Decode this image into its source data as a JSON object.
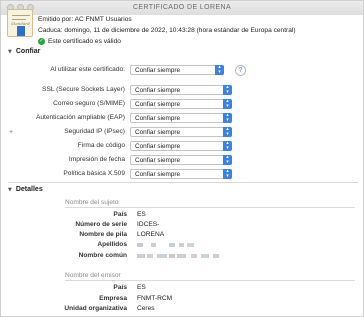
{
  "window": {
    "title": "CERTIFICADO DE LORENA"
  },
  "certificate": {
    "issuer": "Emitido por: AC FNMT Usuarios",
    "expires": "Caduca: domingo, 11 de diciembre de 2022, 10:43:28 (hora estándar de Europa central)",
    "valid": "Este certificado es válido",
    "icon_text": "Standard"
  },
  "confiar": {
    "section_title": "Confiar",
    "when_using_label": "Al utilizar este certificado:",
    "when_using_value": "Confiar siempre",
    "rows": [
      {
        "label": "SSL (Secure Sockets Layer)",
        "value": "Confiar siempre"
      },
      {
        "label": "Correo seguro (S/MIME)",
        "value": "Confiar siempre"
      },
      {
        "label": "Autenticación ampliable (EAP)",
        "value": "Confiar siempre"
      },
      {
        "label": "Seguridad IP (IPsec)",
        "value": "Confiar siempre"
      },
      {
        "label": "Firma de código",
        "value": "Confiar siempre"
      },
      {
        "label": "Impresión de fecha",
        "value": "Confiar siempre"
      },
      {
        "label": "Política básica X.509",
        "value": "Confiar siempre"
      }
    ]
  },
  "detalles": {
    "section_title": "Detalles",
    "subject": {
      "title": "Nombre del sujeto",
      "rows": [
        {
          "label": "País",
          "value": "ES"
        },
        {
          "label": "Número de serie",
          "value": "IDCES-"
        },
        {
          "label": "Nombre de pila",
          "value": "LORENA"
        },
        {
          "label": "Apellidos",
          "value": ""
        },
        {
          "label": "Nombre común",
          "value": ""
        }
      ]
    },
    "issuer": {
      "title": "Nombre del emisor",
      "rows": [
        {
          "label": "País",
          "value": "ES"
        },
        {
          "label": "Empresa",
          "value": "FNMT-RCM"
        },
        {
          "label": "Unidad organizativa",
          "value": "Ceres"
        }
      ]
    }
  },
  "colors": {
    "accent": "#3b82e8",
    "valid": "#2aa53a"
  }
}
